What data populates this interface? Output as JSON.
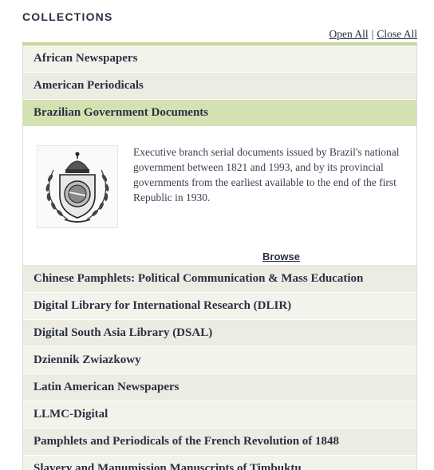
{
  "heading": "COLLECTIONS",
  "toggles": {
    "open_all": "Open All",
    "separator": "|",
    "close_all": "Close All"
  },
  "collections": [
    {
      "label": "African Newspapers"
    },
    {
      "label": "American Periodicals"
    },
    {
      "label": "Brazilian Government Documents"
    },
    {
      "label": "Chinese Pamphlets: Political Communication & Mass Education"
    },
    {
      "label": "Digital Library for International Research (DLIR)"
    },
    {
      "label": "Digital South Asia Library (DSAL)"
    },
    {
      "label": "Dziennik Zwiazkowy"
    },
    {
      "label": "Latin American Newspapers"
    },
    {
      "label": "LLMC-Digital"
    },
    {
      "label": "Pamphlets and Periodicals of the French Revolution of 1848"
    },
    {
      "label": "Slavery and Manumission Manuscripts of Timbuktu"
    }
  ],
  "expanded": {
    "collection": "Brazilian Government Documents",
    "description": "Executive branch serial documents issued by Brazil's national government between 1821 and 1993, and by its provincial governments from the earliest available to the end of the first Republic in 1930.",
    "browse_label": "Browse",
    "image_icon": "brazilian-coat-of-arms"
  },
  "colors": {
    "text": "#2b3044",
    "accent_green": "#c4d69b",
    "open_row_bg": "#d3e2b0",
    "row_bg": "#f3f3ec",
    "row_bg_alt": "#ecece3"
  }
}
